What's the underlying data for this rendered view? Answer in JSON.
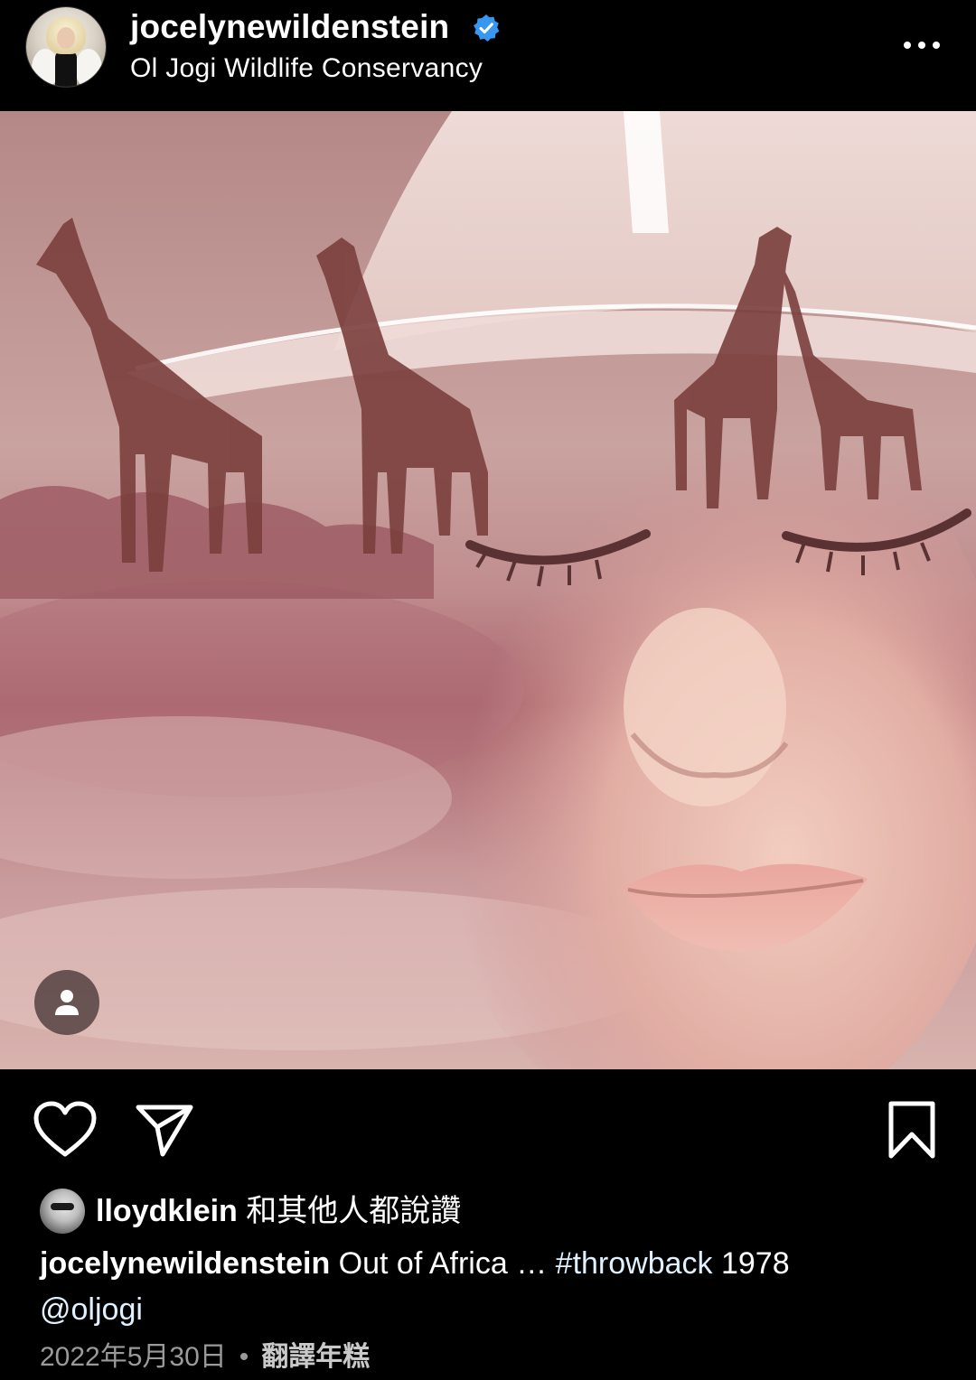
{
  "post": {
    "username": "jocelynewildenstein",
    "location": "Ol Jogi Wildlife Conservancy",
    "verified": true
  },
  "icons": {
    "verified": "verified-badge-icon",
    "more": "more-options-icon",
    "tag": "tagged-people-icon",
    "like": "heart-icon",
    "share": "send-icon",
    "save": "bookmark-icon"
  },
  "likes": {
    "user": "lloydklein",
    "suffix": "和其他人都說讚"
  },
  "caption": {
    "user": "jocelynewildenstein",
    "text": "Out of Africa …",
    "hashtag": "#throwback",
    "year": "1978",
    "mention": "@oljogi"
  },
  "meta": {
    "date": "2022年5月30日",
    "separator": "•",
    "translate": "翻譯年糕"
  },
  "colors": {
    "background": "#000000",
    "verified_blue": "#3897f0",
    "link": "#e0f1ff",
    "meta_gray": "#9a9a9a"
  }
}
